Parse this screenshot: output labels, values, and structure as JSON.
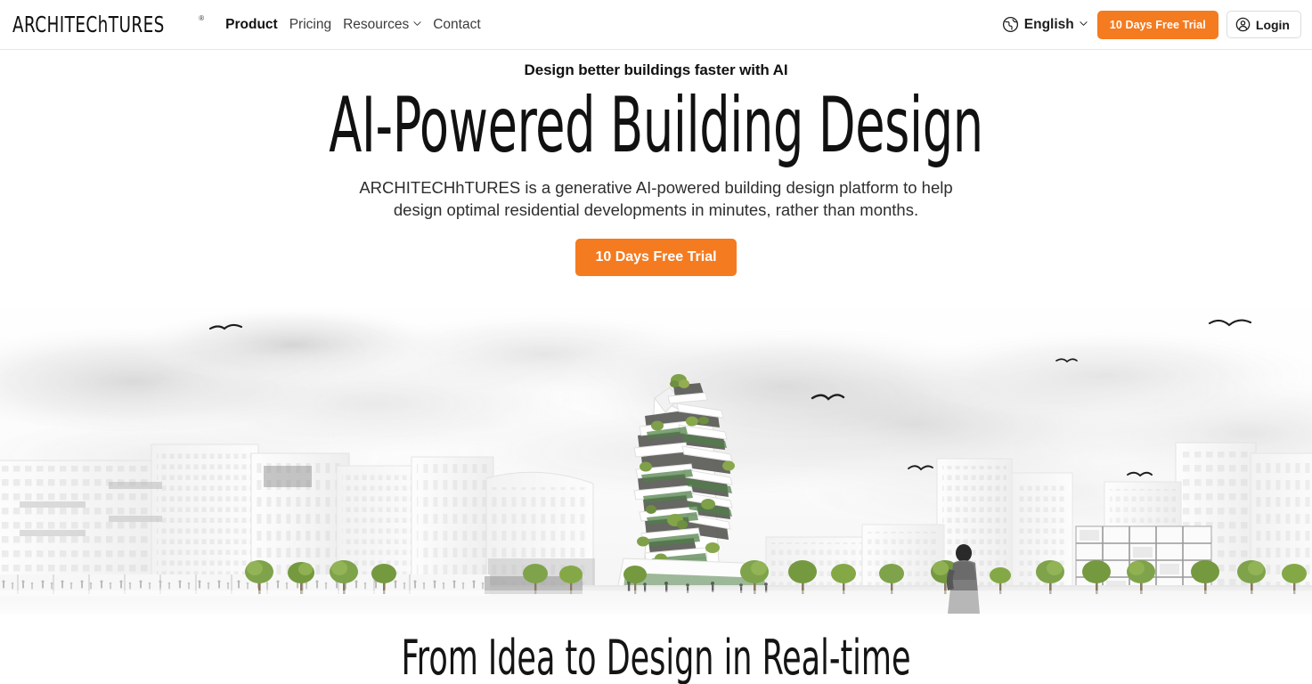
{
  "navbar": {
    "logo": {
      "text": "ARCHITEChTURES",
      "registered_mark": "®"
    },
    "links": [
      {
        "label": "Product",
        "active": true,
        "has_dropdown": false
      },
      {
        "label": "Pricing",
        "active": false,
        "has_dropdown": false
      },
      {
        "label": "Resources",
        "active": false,
        "has_dropdown": true
      },
      {
        "label": "Contact",
        "active": false,
        "has_dropdown": false
      }
    ],
    "language": {
      "label": "English",
      "icon": "globe-icon",
      "caret_icon": "chevron-down-icon"
    },
    "trial_button": {
      "label": "10 Days Free Trial",
      "color": "#F47B20"
    },
    "login_button": {
      "label": "Login",
      "icon": "user-circle-icon"
    }
  },
  "hero": {
    "eyebrow": "Design better buildings faster with AI",
    "headline": "AI-Powered Building Design",
    "subtext": "ARCHITECHhTURES is a generative AI-powered building design platform to help design optimal residential developments in minutes, rather than months.",
    "subtext_line1": "ARCHITECHhTURES is a generative AI-powered building design platform to help design",
    "subtext_line2": "optimal residential developments in minutes, rather than months.",
    "cta": {
      "label": "10 Days Free Trial",
      "color": "#F47B20"
    },
    "image_alt": "Architectural rendering of a stacked green-terraced residential tower in a white city plaza"
  },
  "section_below": {
    "title": "From Idea to Design in Real-time"
  },
  "colors": {
    "accent_orange": "#F47B20",
    "text_dark": "#111111",
    "text_body": "#2e2e2e",
    "border_light": "#e6e6e6",
    "foliage_green": "#6f9c43",
    "terrace_green": "#4f7f46",
    "building_grey": "#5a5a56"
  }
}
